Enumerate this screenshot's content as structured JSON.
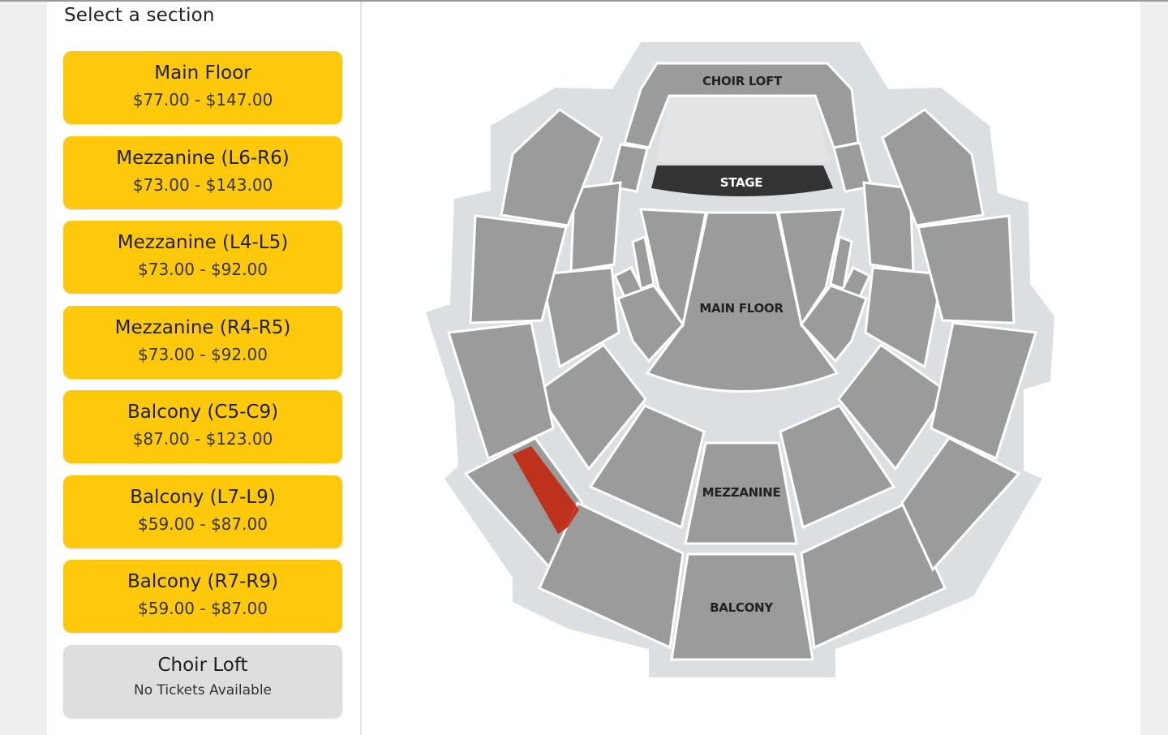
{
  "heading": "Select a section",
  "sections": [
    {
      "name": "Main Floor",
      "price": "$77.00 - $147.00",
      "available": true
    },
    {
      "name": "Mezzanine (L6-R6)",
      "price": "$73.00 - $143.00",
      "available": true
    },
    {
      "name": "Mezzanine (L4-L5)",
      "price": "$73.00 - $92.00",
      "available": true
    },
    {
      "name": "Mezzanine (R4-R5)",
      "price": "$73.00 - $92.00",
      "available": true
    },
    {
      "name": "Balcony (C5-C9)",
      "price": "$87.00 - $123.00",
      "available": true
    },
    {
      "name": "Balcony (L7-L9)",
      "price": "$59.00 - $87.00",
      "available": true
    },
    {
      "name": "Balcony (R7-R9)",
      "price": "$59.00 - $87.00",
      "available": true
    },
    {
      "name": "Choir Loft",
      "price": "No Tickets Available",
      "available": false
    }
  ],
  "map": {
    "labels": {
      "choir_loft": "CHOIR LOFT",
      "stage": "STAGE",
      "main_floor": "MAIN FLOOR",
      "mezzanine": "MEZZANINE",
      "balcony": "BALCONY"
    }
  },
  "colors": {
    "available_section": "#ffc90b",
    "unavailable_section": "#dedede",
    "map_block": "#9b9b9b",
    "map_outline": "#dcdfe1",
    "stage": "#333333",
    "highlight": "#c2260f"
  }
}
